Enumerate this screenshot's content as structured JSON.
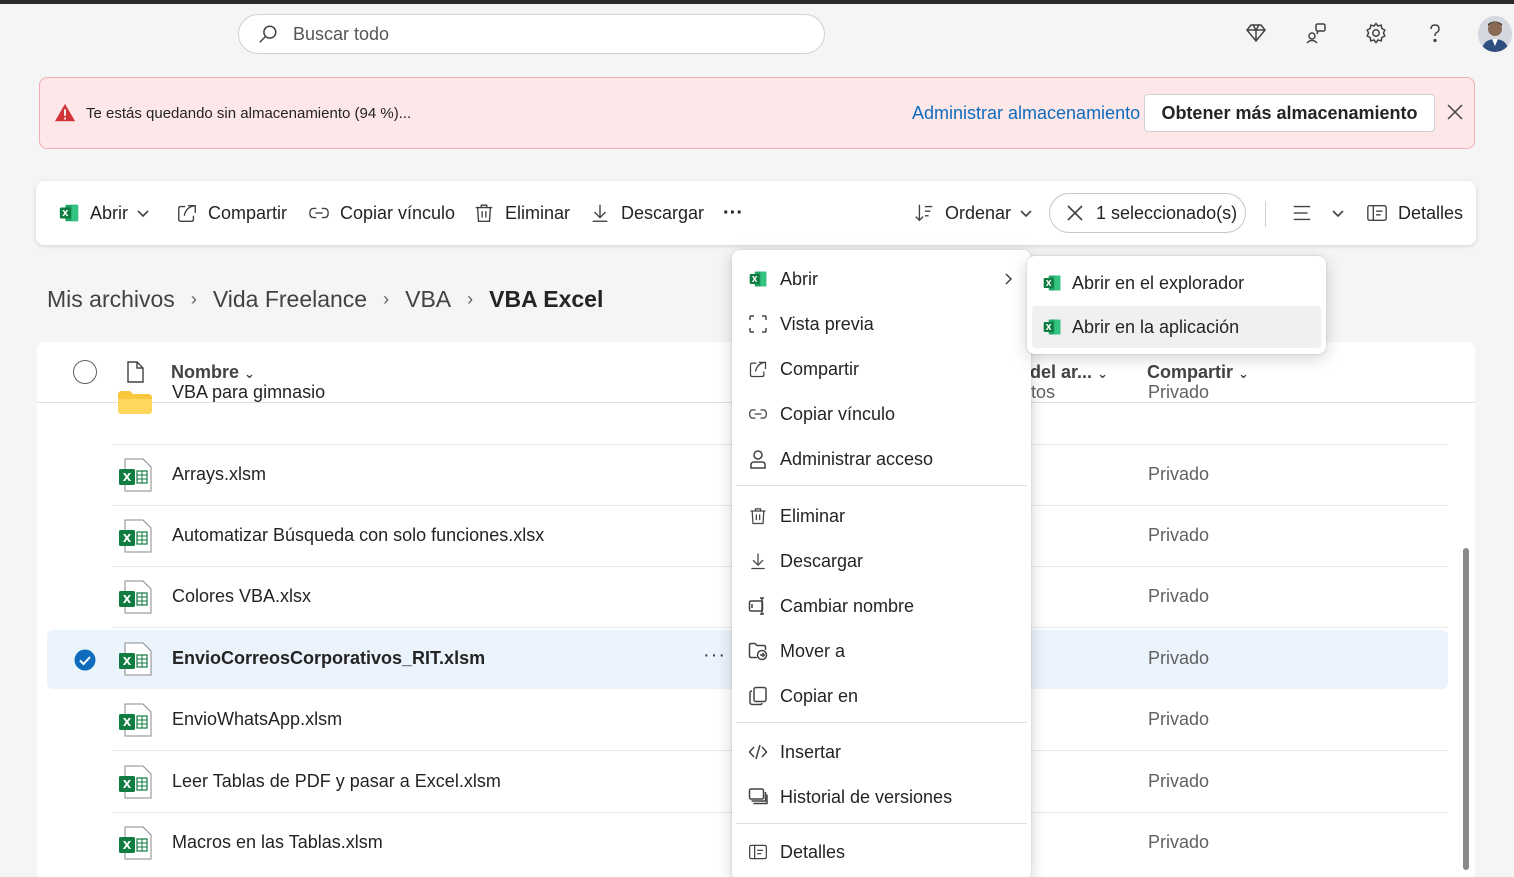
{
  "header": {
    "search_placeholder": "Buscar todo",
    "icons": [
      "diamond-icon",
      "people-icon",
      "gear-icon",
      "help-icon"
    ]
  },
  "banner": {
    "message": "Te estás quedando sin almacenamiento (94 %)...",
    "manage_link": "Administrar almacenamiento",
    "get_more_button": "Obtener más almacenamiento"
  },
  "toolbar": {
    "open": "Abrir",
    "share": "Compartir",
    "copy_link": "Copiar vínculo",
    "delete": "Eliminar",
    "download": "Descargar",
    "more": "···",
    "sort": "Ordenar",
    "selected": "1 seleccionado(s)",
    "details": "Detalles"
  },
  "breadcrumb": [
    "Mis archivos",
    "Vida Freelance",
    "VBA",
    "VBA Excel"
  ],
  "list": {
    "col_name": "Nombre",
    "col_share": "Compartir",
    "col_partial": "del ar...",
    "rows": [
      {
        "name": "VBA para gimnasio",
        "type": "folder",
        "share": "Privado",
        "tail": "tos"
      },
      {
        "name": "Arrays.xlsm",
        "type": "excel",
        "share": "Privado"
      },
      {
        "name": "Automatizar Búsqueda con solo funciones.xlsx",
        "type": "excel",
        "share": "Privado"
      },
      {
        "name": "Colores VBA.xlsx",
        "type": "excel",
        "share": "Privado"
      },
      {
        "name": "EnvioCorreosCorporativos_RIT.xlsm",
        "type": "excel",
        "share": "Privado",
        "selected": true
      },
      {
        "name": "EnvioWhatsApp.xlsm",
        "type": "excel",
        "share": "Privado"
      },
      {
        "name": "Leer Tablas de PDF y pasar a Excel.xlsm",
        "type": "excel",
        "share": "Privado"
      },
      {
        "name": "Macros en las Tablas.xlsm",
        "type": "excel",
        "share": "Privado"
      }
    ]
  },
  "context_menu": {
    "items": [
      {
        "label": "Abrir",
        "icon": "excel-icon"
      },
      {
        "label": "Vista previa",
        "icon": "preview-icon"
      },
      {
        "label": "Compartir",
        "icon": "share-icon"
      },
      {
        "label": "Copiar vínculo",
        "icon": "link-icon"
      },
      {
        "label": "Administrar acceso",
        "icon": "person-icon"
      },
      {
        "label": "Eliminar",
        "icon": "trash-icon"
      },
      {
        "label": "Descargar",
        "icon": "download-icon"
      },
      {
        "label": "Cambiar nombre",
        "icon": "rename-icon"
      },
      {
        "label": "Mover a",
        "icon": "move-icon"
      },
      {
        "label": "Copiar en",
        "icon": "copy-icon"
      },
      {
        "label": "Insertar",
        "icon": "embed-icon"
      },
      {
        "label": "Historial de versiones",
        "icon": "history-icon"
      },
      {
        "label": "Detalles",
        "icon": "details-icon"
      }
    ]
  },
  "submenu": {
    "items": [
      {
        "label": "Abrir en el explorador"
      },
      {
        "label": "Abrir en la aplicación"
      }
    ]
  },
  "colors": {
    "accent": "#0f6cbd",
    "excel_green": "#107c41",
    "banner_bg": "#fde7e9",
    "warning_red": "#d13438",
    "selected_row": "#ebf3fc"
  }
}
